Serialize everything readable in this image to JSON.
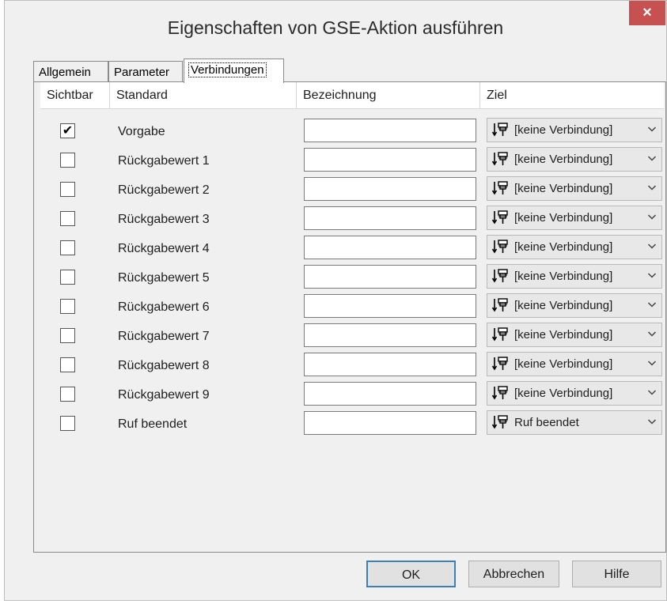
{
  "window": {
    "title": "Eigenschaften von GSE-Aktion ausführen",
    "close_label": "×"
  },
  "tabs": [
    {
      "label": "Allgemein",
      "active": false
    },
    {
      "label": "Parameter",
      "active": false
    },
    {
      "label": "Verbindungen",
      "active": true
    }
  ],
  "table": {
    "columns": [
      "Sichtbar",
      "Standard",
      "Bezeichnung",
      "Ziel"
    ],
    "rows": [
      {
        "checked": true,
        "check_glyph": "✔",
        "standard": "Vorgabe",
        "bezeichnung": "",
        "ziel": "[keine Verbindung]"
      },
      {
        "checked": false,
        "check_glyph": "",
        "standard": "Rückgabewert 1",
        "bezeichnung": "",
        "ziel": "[keine Verbindung]"
      },
      {
        "checked": false,
        "check_glyph": "",
        "standard": "Rückgabewert 2",
        "bezeichnung": "",
        "ziel": "[keine Verbindung]"
      },
      {
        "checked": false,
        "check_glyph": "",
        "standard": "Rückgabewert 3",
        "bezeichnung": "",
        "ziel": "[keine Verbindung]"
      },
      {
        "checked": false,
        "check_glyph": "",
        "standard": "Rückgabewert 4",
        "bezeichnung": "",
        "ziel": "[keine Verbindung]"
      },
      {
        "checked": false,
        "check_glyph": "",
        "standard": "Rückgabewert 5",
        "bezeichnung": "",
        "ziel": "[keine Verbindung]"
      },
      {
        "checked": false,
        "check_glyph": "",
        "standard": "Rückgabewert 6",
        "bezeichnung": "",
        "ziel": "[keine Verbindung]"
      },
      {
        "checked": false,
        "check_glyph": "",
        "standard": "Rückgabewert 7",
        "bezeichnung": "",
        "ziel": "[keine Verbindung]"
      },
      {
        "checked": false,
        "check_glyph": "",
        "standard": "Rückgabewert 8",
        "bezeichnung": "",
        "ziel": "[keine Verbindung]"
      },
      {
        "checked": false,
        "check_glyph": "",
        "standard": "Rückgabewert 9",
        "bezeichnung": "",
        "ziel": "[keine Verbindung]"
      },
      {
        "checked": false,
        "check_glyph": "",
        "standard": "Ruf beendet",
        "bezeichnung": "",
        "ziel": "Ruf beendet"
      }
    ],
    "ziel_icon": "connection-target-icon"
  },
  "buttons": {
    "ok": "OK",
    "cancel": "Abbrechen",
    "help": "Hilfe"
  },
  "colors": {
    "close_button": "#c75050",
    "default_button_border": "#3c7fb1"
  }
}
